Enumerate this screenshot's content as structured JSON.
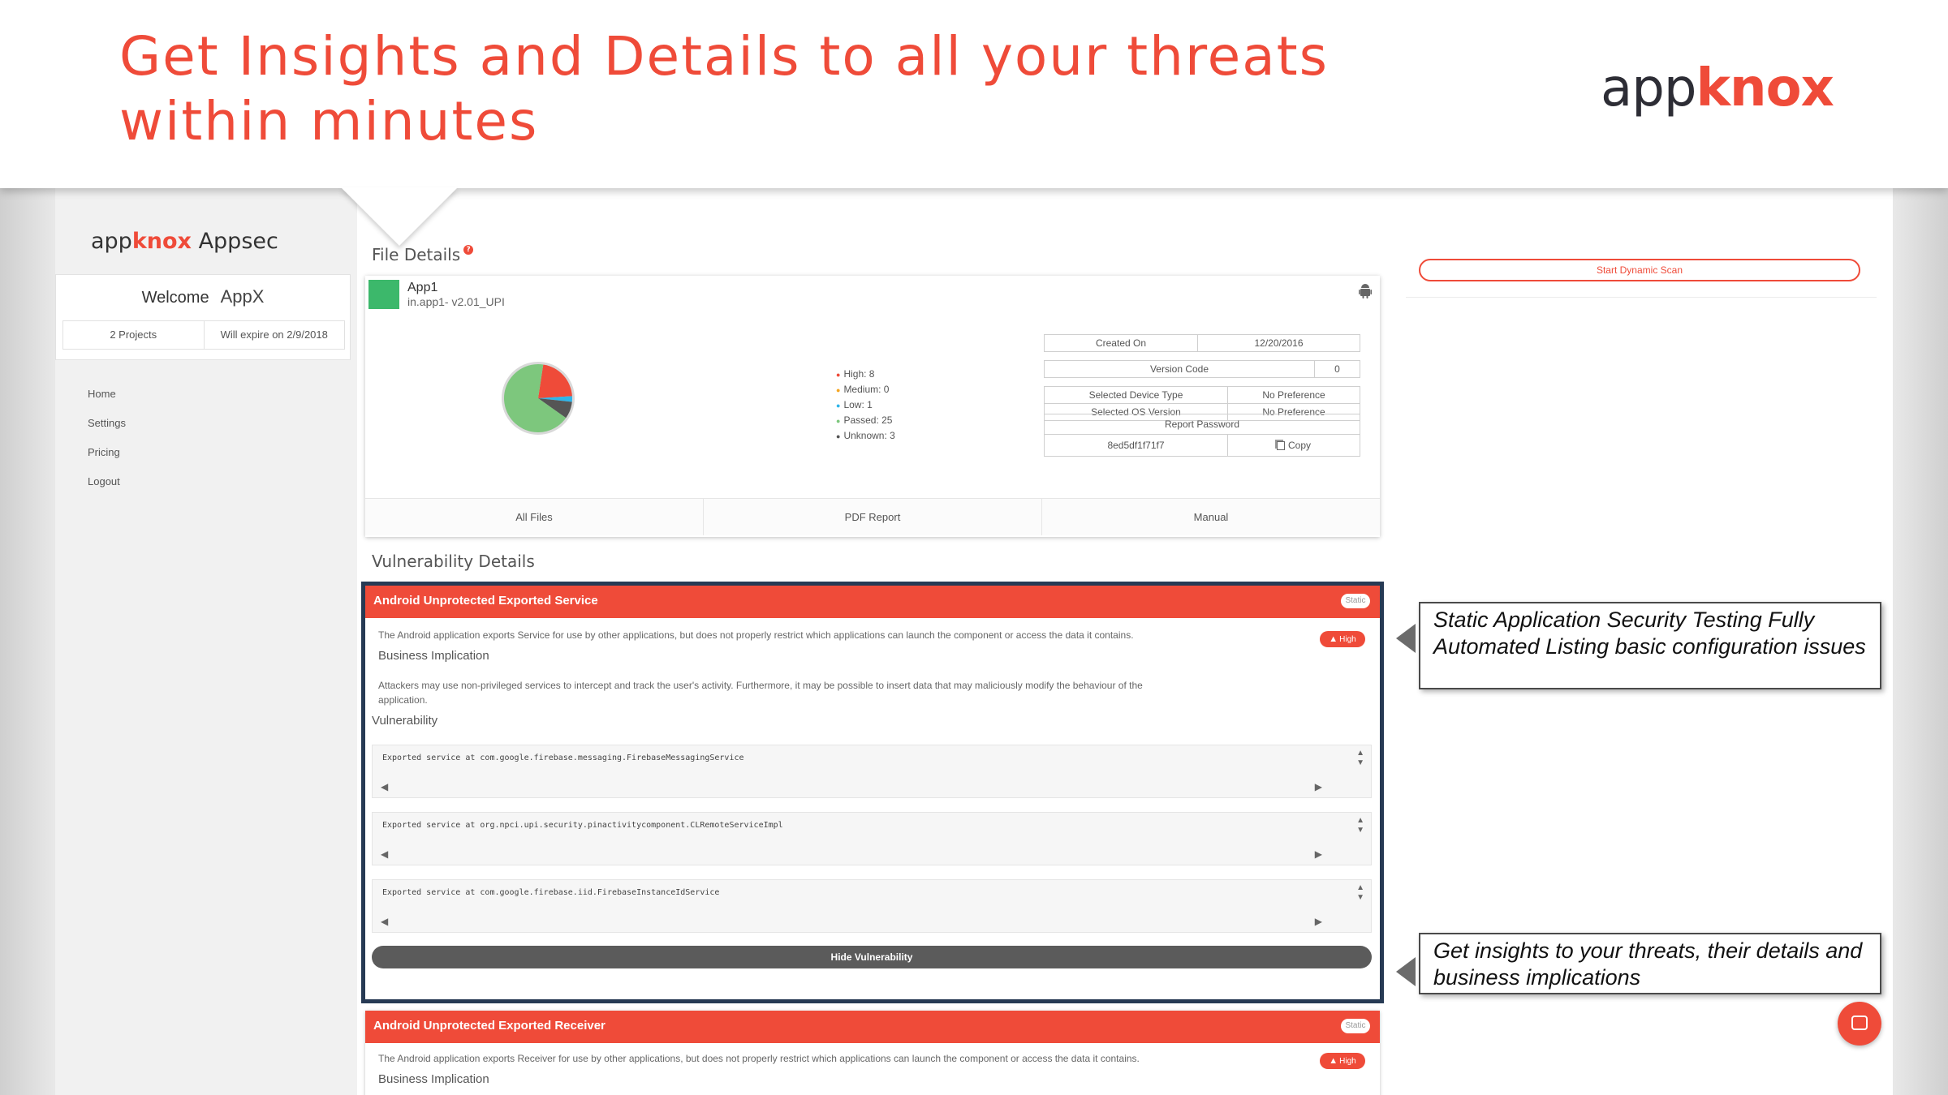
{
  "slide": {
    "headline_line1": "Get Insights and Details to all your threats",
    "headline_line2": "within minutes",
    "brand_app": "app",
    "brand_knox": "knox"
  },
  "sidebar": {
    "logo_app": "app",
    "logo_knox": "knox",
    "logo_suffix": "Appsec",
    "welcome_label": "Welcome",
    "user_name": "AppX",
    "projects": "2 Projects",
    "expiry": "Will expire on 2/9/2018",
    "nav": [
      "Home",
      "Settings",
      "Pricing",
      "Logout"
    ]
  },
  "file_details": {
    "title": "File Details",
    "help_icon": "?",
    "app_name": "App1",
    "package": "in.app1- v2.01_UPI",
    "platform_icon": "android-icon",
    "legend": {
      "high": "High: 8",
      "medium": "Medium: 0",
      "low": "Low: 1",
      "passed": "Passed: 25",
      "unknown": "Unknown: 3"
    },
    "pie": {
      "high": 8,
      "medium": 0,
      "low": 1,
      "passed": 25,
      "unknown": 3
    },
    "colors": {
      "high": "#ef4b39",
      "medium": "#f5a623",
      "low": "#2fb5e9",
      "passed": "#7dc77d",
      "unknown": "#555555"
    },
    "created_on_label": "Created On",
    "created_on_value": "12/20/2016",
    "version_code_label": "Version Code",
    "version_code_value": "0",
    "device_type_label": "Selected Device Type",
    "device_type_value": "No Preference",
    "os_version_label": "Selected OS Version",
    "os_version_value": "No Preference",
    "report_password_label": "Report Password",
    "report_password_value": "8ed5df1f71f7",
    "copy_label": "Copy",
    "footer": [
      "All Files",
      "PDF Report",
      "Manual"
    ],
    "dynamic_scan_label": "Start Dynamic Scan"
  },
  "vulnerability_details": {
    "title": "Vulnerability Details",
    "items": [
      {
        "title": "Android Unprotected Exported Service",
        "type_badge": "Static",
        "severity": "High",
        "description": "The Android application exports Service for use by other applications, but does not properly restrict which applications can launch the component or access the data it contains.",
        "business_label": "Business Implication",
        "business_text": "Attackers may use non-privileged services to intercept and track the user's activity. Furthermore, it may be possible to insert data that may maliciously modify the behaviour of the application.",
        "vulnerability_label": "Vulnerability",
        "findings": [
          "Exported service at com.google.firebase.messaging.FirebaseMessagingService",
          "Exported service at org.npci.upi.security.pinactivitycomponent.CLRemoteServiceImpl",
          "Exported service at com.google.firebase.iid.FirebaseInstanceIdService"
        ],
        "hide_label": "Hide Vulnerability"
      },
      {
        "title": "Android Unprotected Exported Receiver",
        "type_badge": "Static",
        "severity": "High",
        "description": "The Android application exports Receiver for use by other applications, but does not properly restrict which applications can launch the component or access the data it contains.",
        "business_label": "Business Implication"
      }
    ]
  },
  "callouts": {
    "sast": "Static Application Security Testing Fully Automated Listing basic configuration issues",
    "insights": "Get insights to your threats, their details and business implications"
  },
  "chat_icon": "chat-icon"
}
